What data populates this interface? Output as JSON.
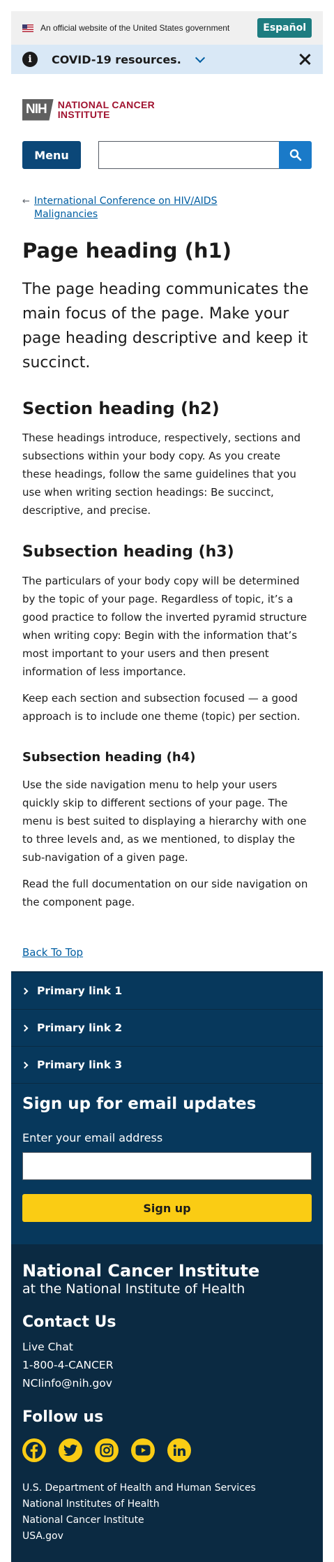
{
  "gov_banner": {
    "text": "An official website of the United States government",
    "language_button": "Español"
  },
  "alert": {
    "text": "COVID-19 resources."
  },
  "logo": {
    "abbr": "NIH",
    "line1": "NATIONAL CANCER",
    "line2": "INSTITUTE"
  },
  "nav": {
    "menu_label": "Menu",
    "search_value": ""
  },
  "breadcrumb": {
    "link_line1": "International Conference on HIV/AIDS",
    "link_line2": "Malignancies"
  },
  "content": {
    "h1": "Page heading (h1)",
    "lead": "The page heading communicates the main focus of the page. Make your page heading descriptive and keep it succinct.",
    "h2": "Section heading (h2)",
    "p1": "These headings introduce, respectively, sections and subsections within your body copy. As you create these headings, follow the same guidelines that you use when writing section headings: Be succinct, descriptive, and precise.",
    "h3": "Subsection heading (h3)",
    "p2": "The particulars of your body copy will be determined by the topic of your page. Regardless of topic, it’s a good practice to follow the inverted pyramid structure when writing copy: Begin with the information that’s most important to your users and then present information of less importance.",
    "p3": "Keep each section and subsection focused — a good approach is to include one theme (topic) per section.",
    "h4": "Subsection heading (h4)",
    "p4": "Use the side navigation menu to help your users quickly skip to different sections of your page. The menu is best suited to displaying a hierarchy with one to three levels and, as we mentioned, to display the sub-navigation of a given page.",
    "p5": "Read the full documentation on our side navigation on the component page.",
    "back_to_top": "Back To Top"
  },
  "primary_links": [
    "Primary link 1",
    "Primary link 2",
    "Primary link 3"
  ],
  "signup": {
    "title": "Sign up for email updates",
    "label": "Enter your email address",
    "email_value": "",
    "button": "Sign up"
  },
  "footer": {
    "title": "National Cancer Institute",
    "subtitle": "at the National Institute of Health",
    "contact_title": "Contact Us",
    "contact": [
      "Live Chat",
      "1-800-4-CANCER",
      "NCIinfo@nih.gov"
    ],
    "follow_title": "Follow us",
    "social": [
      "facebook-icon",
      "twitter-icon",
      "instagram-icon",
      "youtube-icon",
      "linkedin-icon"
    ],
    "links": [
      "U.S. Department of Health and Human Services",
      "National Institutes of Health",
      "National Cancer Institute",
      "USA.gov"
    ]
  },
  "colors": {
    "banner_bg": "#f0f0f0",
    "alert_bg": "#d9e8f6",
    "brand_red": "#a0122f",
    "menu_blue": "#0b4778",
    "link_blue": "#005ea2",
    "primary_bg": "#07385c",
    "footer_bg": "#0b2a42",
    "accent_yellow": "#facc14"
  }
}
